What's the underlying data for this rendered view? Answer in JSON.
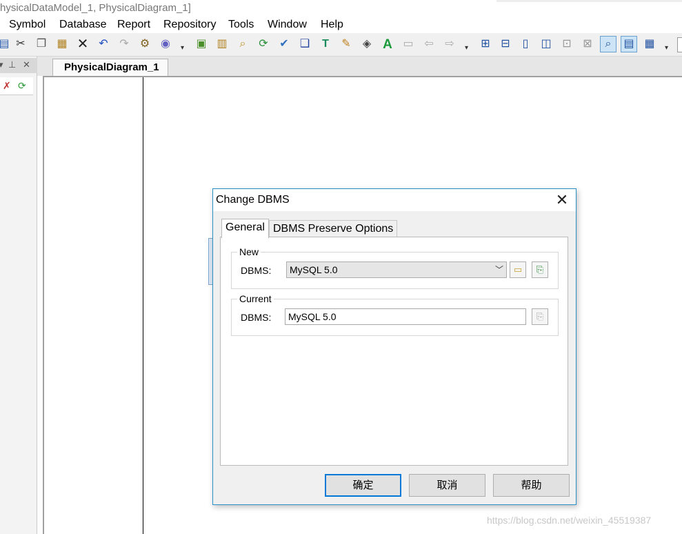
{
  "window": {
    "title": "hysicalDataModel_1, PhysicalDiagram_1]"
  },
  "menu": {
    "items": [
      "Symbol",
      "Database",
      "Report",
      "Repository",
      "Tools",
      "Window",
      "Help"
    ]
  },
  "toolbar": {
    "icons": [
      "save-icon",
      "cut-icon",
      "copy-icon",
      "paste-icon",
      "delete-icon",
      "undo-icon",
      "redo-icon",
      "properties-icon",
      "model-icon",
      "new-icon",
      "open-icon",
      "find-icon",
      "refresh-icon",
      "check-icon",
      "shadow-icon",
      "text-icon",
      "brush-icon",
      "format-icon",
      "font-icon",
      "import-icon",
      "back-icon",
      "forward-icon",
      "diagram1-icon",
      "diagram2-icon",
      "diagram3-icon",
      "diagram4-icon",
      "diagram5-icon",
      "diagram6-icon",
      "preview-icon",
      "comment-icon",
      "table-icon"
    ]
  },
  "left_panel": {
    "header_icons": [
      "pin-icon",
      "close-icon"
    ]
  },
  "document_tab": {
    "label": "PhysicalDiagram_1"
  },
  "dialog": {
    "title": "Change DBMS",
    "close_glyph": "✕",
    "tabs": [
      "General",
      "DBMS Preserve Options"
    ],
    "new_group": {
      "label": "New",
      "field_label": "DBMS:",
      "value": "MySQL 5.0"
    },
    "current_group": {
      "label": "Current",
      "field_label": "DBMS:",
      "value": "MySQL 5.0"
    },
    "buttons": {
      "ok": "确定",
      "cancel": "取消",
      "help": "帮助"
    }
  },
  "watermark": "https://blog.csdn.net/weixin_45519387"
}
